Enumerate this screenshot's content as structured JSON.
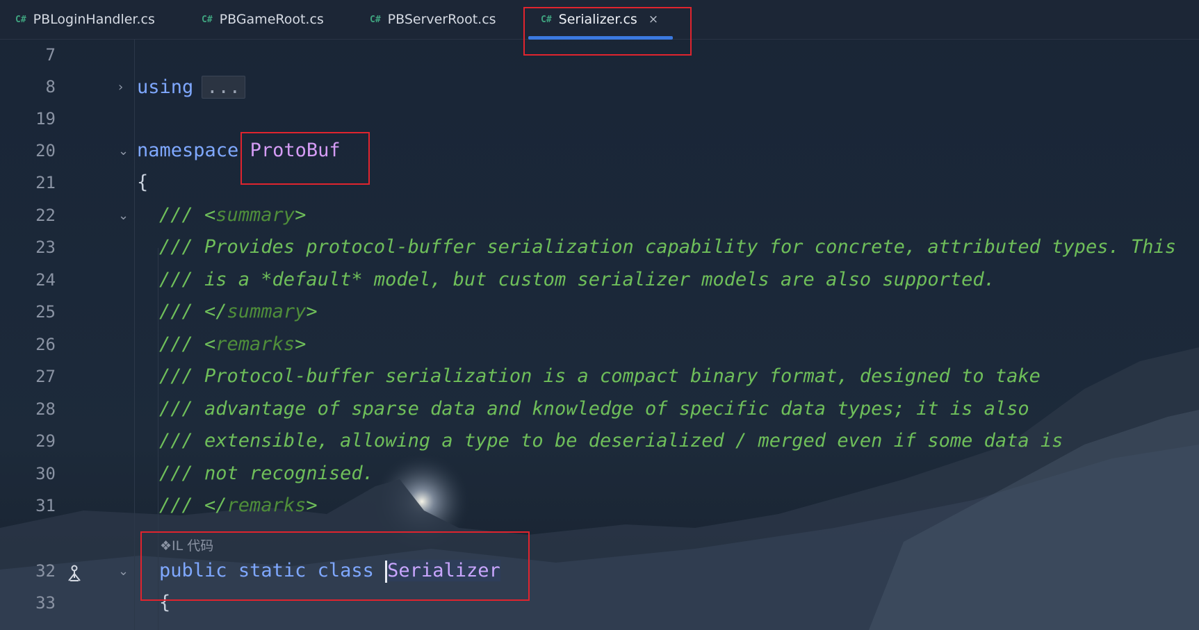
{
  "tabs": [
    {
      "icon": "C#",
      "label": "PBLoginHandler.cs",
      "active": false
    },
    {
      "icon": "C#",
      "label": "PBGameRoot.cs",
      "active": false
    },
    {
      "icon": "C#",
      "label": "PBServerRoot.cs",
      "active": false
    },
    {
      "icon": "C#",
      "label": "Serializer.cs",
      "active": true,
      "close": "×"
    }
  ],
  "colors": {
    "accent_underline": "#3b79e0",
    "highlight_box": "#e0242e",
    "keyword": "#7fa8ff",
    "comment": "#6fbf5a",
    "namespace": "#d59cf5"
  },
  "lines": {
    "l7": {
      "num": "7"
    },
    "l8": {
      "num": "8",
      "kw": "using",
      "fold": "..."
    },
    "l19": {
      "num": "19"
    },
    "l20": {
      "num": "20",
      "kw": "namespace",
      "name": "ProtoBuf"
    },
    "l21": {
      "num": "21",
      "text": "{"
    },
    "l22": {
      "num": "22",
      "pre": "/// <",
      "tag": "summary",
      "post": ">"
    },
    "l23": {
      "num": "23",
      "text": "/// Provides protocol-buffer serialization capability for concrete, attributed types. This"
    },
    "l24": {
      "num": "24",
      "text": "/// is a *default* model, but custom serializer models are also supported."
    },
    "l25": {
      "num": "25",
      "pre": "/// </",
      "tag": "summary",
      "post": ">"
    },
    "l26": {
      "num": "26",
      "pre": "/// <",
      "tag": "remarks",
      "post": ">"
    },
    "l27": {
      "num": "27",
      "text": "/// Protocol-buffer serialization is a compact binary format, designed to take"
    },
    "l28": {
      "num": "28",
      "text": "/// advantage of sparse data and knowledge of specific data types; it is also"
    },
    "l29": {
      "num": "29",
      "text": "/// extensible, allowing a type to be deserialized / merged even if some data is"
    },
    "l30": {
      "num": "30",
      "text": "/// not recognised."
    },
    "l31": {
      "num": "31",
      "pre": "/// </",
      "tag": "remarks",
      "post": ">"
    },
    "il_hint": "❖IL 代码",
    "l32": {
      "num": "32",
      "kw1": "public",
      "kw2": "static",
      "kw3": "class",
      "name": "Serializer"
    },
    "l33": {
      "num": "33",
      "text": "{"
    }
  }
}
